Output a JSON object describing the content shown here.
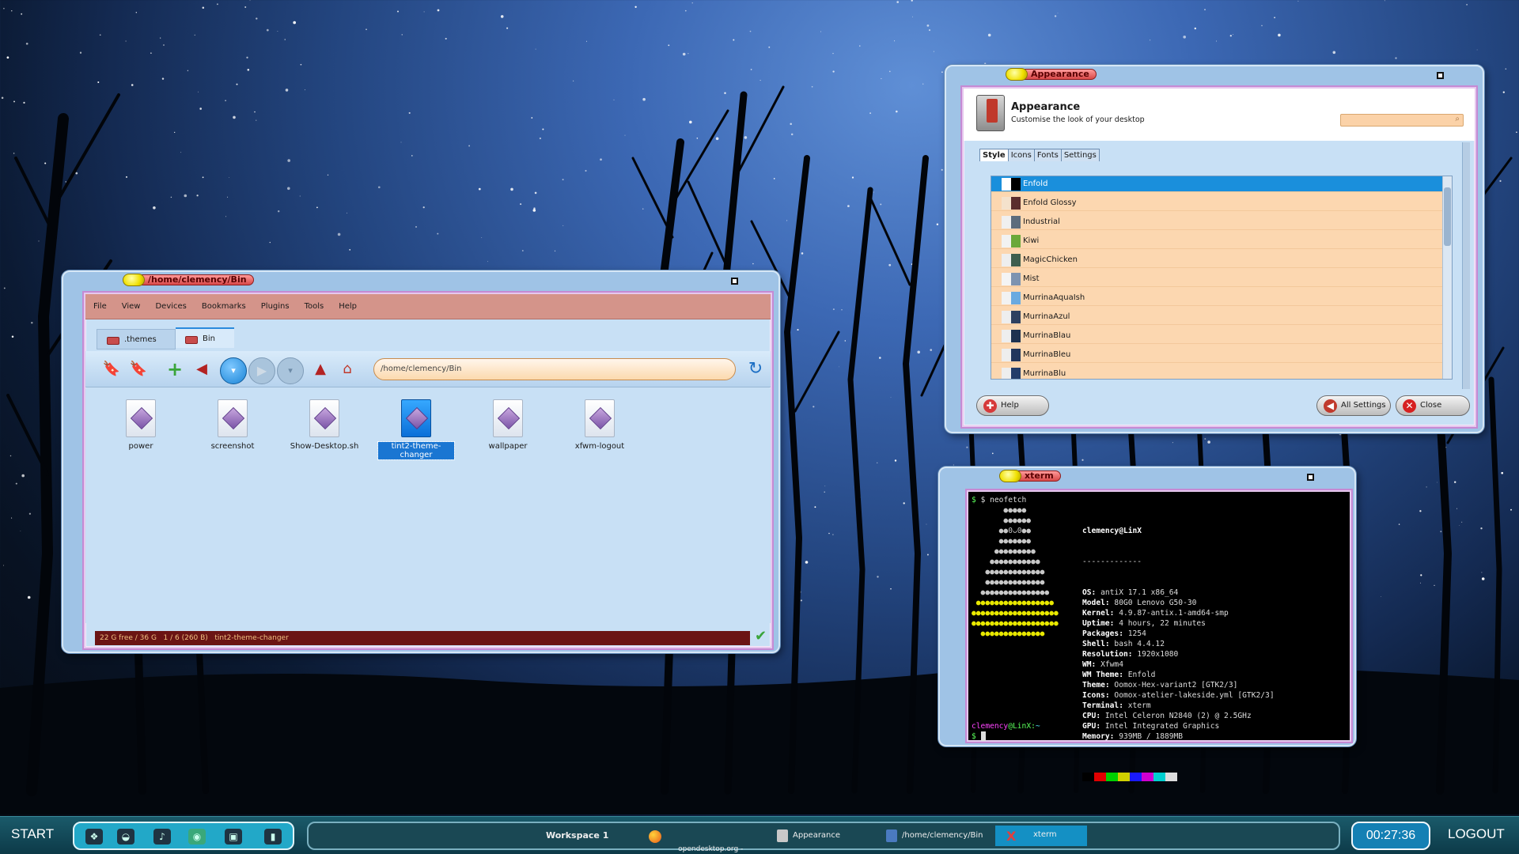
{
  "filemanager": {
    "title": "/home/clemency/Bin",
    "menu": [
      "File",
      "View",
      "Devices",
      "Bookmarks",
      "Plugins",
      "Tools",
      "Help"
    ],
    "tabs": [
      ".themes",
      "Bin"
    ],
    "address": "/home/clemency/Bin",
    "files": [
      {
        "name": "power"
      },
      {
        "name": "screenshot"
      },
      {
        "name": "Show-Desktop.sh"
      },
      {
        "name": "tint2-theme-changer"
      },
      {
        "name": "wallpaper"
      },
      {
        "name": "xfwm-logout"
      }
    ],
    "status": "22 G free / 36 G   1 / 6 (260 B)   tint2-theme-changer"
  },
  "appearance": {
    "title": "Appearance",
    "heading": "Appearance",
    "subheading": "Customise the look of your desktop",
    "tabs": [
      "Style",
      "Icons",
      "Fonts",
      "Settings"
    ],
    "themes": [
      "Enfold",
      "Enfold Glossy",
      "Industrial",
      "Kiwi",
      "MagicChicken",
      "Mist",
      "MurrinaAquaIsh",
      "MurrinaAzul",
      "MurrinaBlau",
      "MurrinaBleu",
      "MurrinaBlu"
    ],
    "help_label": "Help",
    "all_settings_label": "All Settings",
    "close_label": "Close"
  },
  "xterm": {
    "title": "xterm",
    "command": "$ neofetch",
    "user_host": "clemency@LinX",
    "separator": "-------------",
    "info": [
      {
        "k": "OS:",
        "v": " antiX 17.1 x86_64"
      },
      {
        "k": "Model:",
        "v": " 80G0 Lenovo G50-30"
      },
      {
        "k": "Kernel:",
        "v": " 4.9.87-antix.1-amd64-smp"
      },
      {
        "k": "Uptime:",
        "v": " 4 hours, 22 minutes"
      },
      {
        "k": "Packages:",
        "v": " 1254"
      },
      {
        "k": "Shell:",
        "v": " bash 4.4.12"
      },
      {
        "k": "Resolution:",
        "v": " 1920x1080"
      },
      {
        "k": "WM:",
        "v": " Xfwm4"
      },
      {
        "k": "WM Theme:",
        "v": " Enfold"
      },
      {
        "k": "Theme:",
        "v": " Oomox-Hex-variant2 [GTK2/3]"
      },
      {
        "k": "Icons:",
        "v": " Oomox-atelier-lakeside.yml [GTK2/3]"
      },
      {
        "k": "Terminal:",
        "v": " xterm"
      },
      {
        "k": "CPU:",
        "v": " Intel Celeron N2840 (2) @ 2.5GHz"
      },
      {
        "k": "GPU:",
        "v": " Intel Integrated Graphics"
      },
      {
        "k": "Memory:",
        "v": " 939MB / 1889MB"
      }
    ],
    "prompt_user": "clemency",
    "prompt_host": "@LinX:",
    "prompt_path": "~",
    "prompt_symbol": "$",
    "palette": [
      "#000000",
      "#e00000",
      "#00d000",
      "#d0d000",
      "#1a1aff",
      "#d000d0",
      "#00d0d0",
      "#dddddd"
    ],
    "logo_lines": [
      "       ●●●●●",
      "       ●●●●●●",
      "      ●●0ᴗ0●●",
      "      ●●●●●●●",
      "     ●●●●●●●●●",
      "    ●●●●●●●●●●●",
      "   ●●●●●●●●●●●●●",
      "   ●●●●●●●●●●●●●",
      "  ●●●●●●●●●●●●●●●",
      " ●●●●●●●●●●●●●●●●●",
      "●●●●●●●●●●●●●●●●●●●",
      "●●●●●●●●●●●●●●●●●●●",
      "  ●●●●●●●●●●●●●●"
    ]
  },
  "panel": {
    "start_label": "START",
    "workspace": "Workspace 1",
    "tasks": [
      {
        "label": "opendesktop.org -\nMozilla Firefox",
        "icon": "firefox-icon"
      },
      {
        "label": "Appearance",
        "icon": "appearance-icon"
      },
      {
        "label": "/home/clemency/Bin",
        "icon": "filemanager-icon"
      },
      {
        "label": "xterm",
        "icon": "xterm-icon"
      }
    ],
    "clock": "00:27:36",
    "logout_label": "LOGOUT"
  },
  "colors": {
    "window_blue": "#9fc3e6",
    "title_pill": "#d84848",
    "list_peach": "#fcd7b0",
    "selection": "#1a8fdc",
    "panel": "#0d3a48"
  }
}
